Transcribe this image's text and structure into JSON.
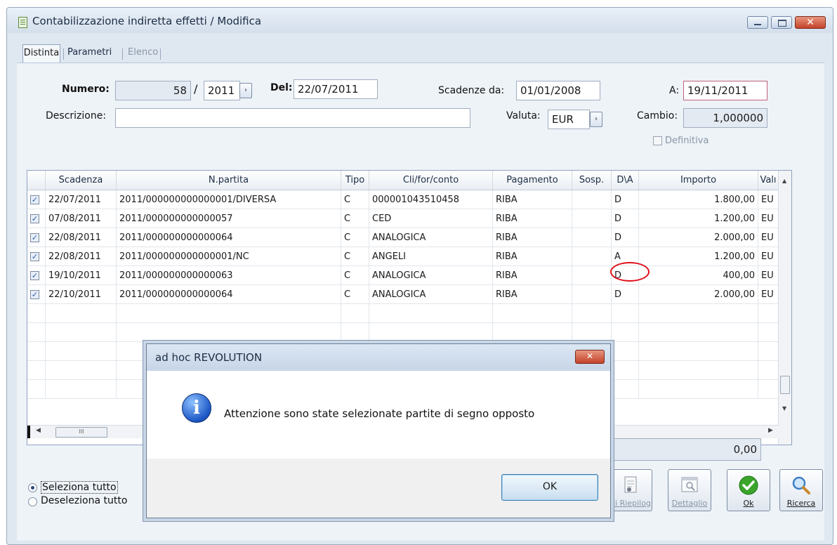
{
  "window": {
    "title": "Contabilizzazione indiretta effetti / Modifica",
    "close_glyph": "✕"
  },
  "tabs": [
    {
      "label": "Distinta"
    },
    {
      "label": "Parametri"
    },
    {
      "label": "Elenco"
    }
  ],
  "form": {
    "numero_label": "Numero:",
    "numero_value": "58",
    "slash": "/",
    "anno_value": "2011",
    "del_label": "Del:",
    "del_value": "22/07/2011",
    "scadenze_label": "Scadenze da:",
    "scadenze_value": "01/01/2008",
    "a_label": "A:",
    "a_value": "19/11/2011",
    "descrizione_label": "Descrizione:",
    "descrizione_value": "",
    "valuta_label": "Valuta:",
    "valuta_value": "EUR",
    "cambio_label": "Cambio:",
    "cambio_value": "1,000000",
    "definitiva_label": "Definitiva",
    "arrow_glyph": "›"
  },
  "grid": {
    "columns": [
      "Scadenza",
      "N.partita",
      "Tipo",
      "Cli/for/conto",
      "Pagamento",
      "Sosp.",
      "D\\A",
      "Importo",
      "Valı"
    ],
    "rows": [
      {
        "scadenza": "22/07/2011",
        "partita": "2011/000000000000001/DIVERSA",
        "tipo": "C",
        "conto": "000001043510458",
        "pagamento": "RIBA",
        "sosp": "",
        "da": "D",
        "importo": "1.800,00",
        "val": "EU"
      },
      {
        "scadenza": "07/08/2011",
        "partita": "2011/000000000000057",
        "tipo": "C",
        "conto": "CED",
        "pagamento": "RIBA",
        "sosp": "",
        "da": "D",
        "importo": "1.200,00",
        "val": "EU"
      },
      {
        "scadenza": "22/08/2011",
        "partita": "2011/000000000000064",
        "tipo": "C",
        "conto": "ANALOGICA",
        "pagamento": "RIBA",
        "sosp": "",
        "da": "D",
        "importo": "2.000,00",
        "val": "EU"
      },
      {
        "scadenza": "22/08/2011",
        "partita": "2011/000000000000001/NC",
        "tipo": "C",
        "conto": "ANGELI",
        "pagamento": "RIBA",
        "sosp": "",
        "da": "A",
        "importo": "1.200,00",
        "val": "EU"
      },
      {
        "scadenza": "19/10/2011",
        "partita": "2011/000000000000063",
        "tipo": "C",
        "conto": "ANALOGICA",
        "pagamento": "RIBA",
        "sosp": "",
        "da": "D",
        "importo": "400,00",
        "val": "EU"
      },
      {
        "scadenza": "22/10/2011",
        "partita": "2011/000000000000064",
        "tipo": "C",
        "conto": "ANALOGICA",
        "pagamento": "RIBA",
        "sosp": "",
        "da": "D",
        "importo": "2.000,00",
        "val": "EU"
      }
    ],
    "check_glyph": "✓",
    "hscroll_thumb": "III"
  },
  "footer": {
    "totale_value": "0,00",
    "seleziona_tutto": "Seleziona tutto",
    "deseleziona_tutto": "Deseleziona tutto",
    "buttons": {
      "riepilog": "di Riepilog",
      "dettaglio": "Dettaglio",
      "ok": "Ok",
      "ricerca": "Ricerca"
    }
  },
  "dialog": {
    "title": "ad hoc REVOLUTION",
    "message": "Attenzione sono state selezionate partite di segno opposto",
    "ok_label": "OK",
    "icon_glyph": "i",
    "close_glyph": "✕"
  }
}
